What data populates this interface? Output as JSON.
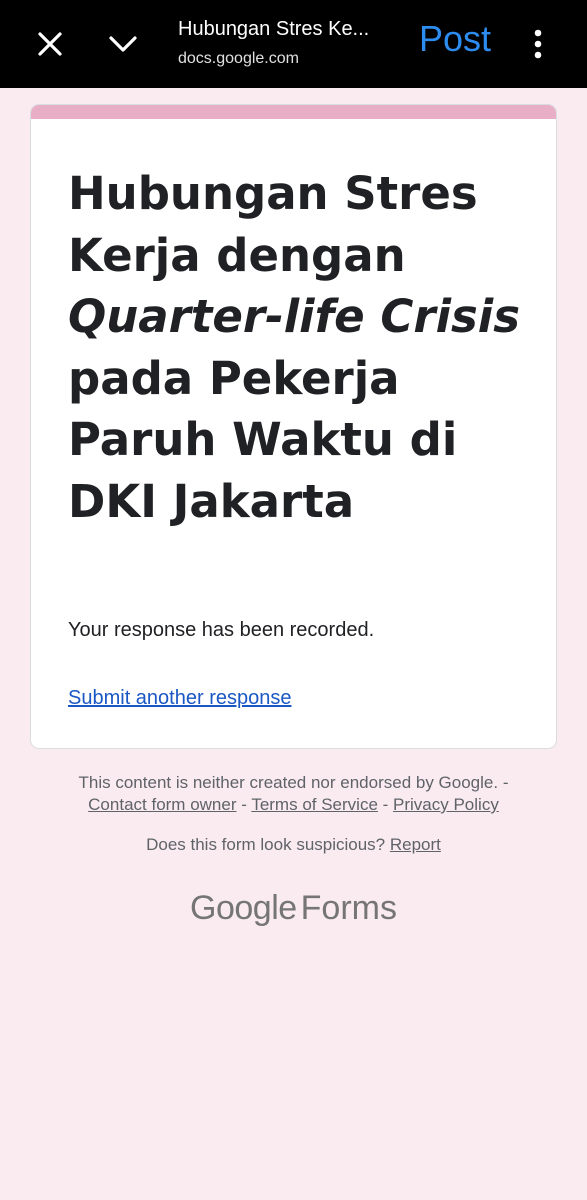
{
  "topbar": {
    "title": "Hubungan Stres Ke...",
    "url": "docs.google.com",
    "post_label": "Post",
    "icons": [
      "close-icon",
      "chevron-down-icon",
      "more-vert-icon"
    ]
  },
  "form": {
    "title_part1": "Hubungan Stres Kerja dengan ",
    "title_italic": "Quarter-life Crisis",
    "title_part2": " pada Pekerja Paruh Waktu di DKI Jakarta",
    "recorded_text": "Your response has been recorded.",
    "another_link": "Submit another response",
    "accent_color": "#e8aec6"
  },
  "footer": {
    "disclaimer": "This content is neither created nor endorsed by Google. -",
    "contact": "Contact form owner",
    "sep1": " - ",
    "terms": "Terms of Service",
    "sep2": " - ",
    "privacy": "Privacy Policy",
    "suspicious_text": "Does this form look suspicious? ",
    "report": "Report"
  },
  "brand": {
    "google": "Google",
    "forms": "Forms"
  }
}
